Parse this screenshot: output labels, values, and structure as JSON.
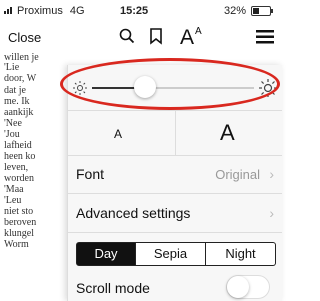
{
  "status": {
    "carrier": "Proximus",
    "network": "4G",
    "time": "15:25",
    "battery": "32%"
  },
  "toolbar": {
    "close_label": "Close",
    "icons": [
      "search-icon",
      "bookmark-icon",
      "text-size-icon",
      "menu-icon"
    ]
  },
  "book_lines": [
    "willen je",
    "'Lie",
    "door, W",
    "dat je",
    "me. Ik",
    "aankijk",
    "'Nee",
    "'Jou",
    "lafheid",
    "heen ko",
    "leven,",
    "worden",
    "'Maa",
    "'Leu",
    "niet sto",
    "beroven",
    "klungel",
    "Worm"
  ],
  "settings": {
    "brightness_level": 0.3,
    "font_small_label": "A",
    "font_large_label": "A",
    "font_label": "Font",
    "font_value": "Original",
    "advanced_label": "Advanced settings",
    "themes": [
      "Day",
      "Sepia",
      "Night"
    ],
    "selected_theme": "Day",
    "scroll_mode_label": "Scroll mode",
    "scroll_mode_on": false
  },
  "colors": {
    "highlight_oval": "#d9281f",
    "selected_theme_bg": "#111111"
  }
}
